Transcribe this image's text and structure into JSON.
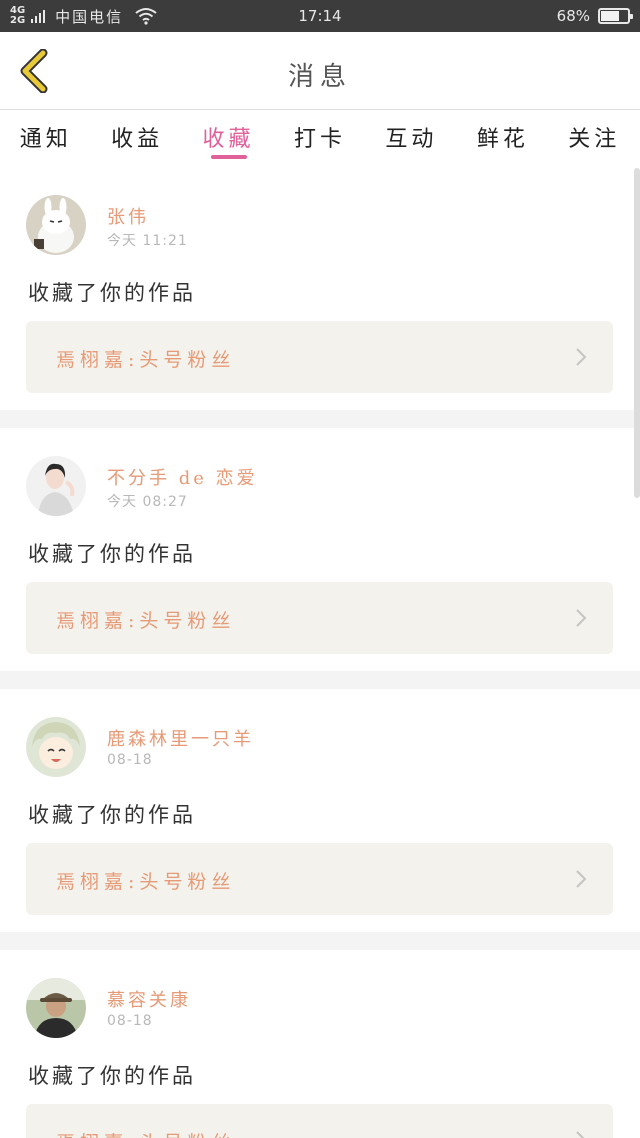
{
  "status_bar": {
    "network_top": "4G",
    "network_bottom": "2G",
    "carrier": "中国电信",
    "time": "17:14",
    "battery": "68%",
    "battery_level": 0.68
  },
  "header": {
    "title": "消息",
    "back_icon": "chevron-left-icon",
    "back_color": "#e8c938"
  },
  "tabs": [
    {
      "label": "通知",
      "active": false
    },
    {
      "label": "收益",
      "active": false
    },
    {
      "label": "收藏",
      "active": true
    },
    {
      "label": "打卡",
      "active": false
    },
    {
      "label": "互动",
      "active": false
    },
    {
      "label": "鲜花",
      "active": false
    },
    {
      "label": "关注",
      "active": false
    }
  ],
  "colors": {
    "accent": "#e0609a",
    "username": "#e69a76",
    "work_box_bg": "#f4f2ec"
  },
  "messages": [
    {
      "username": "张伟",
      "time": "今天 11:21",
      "action": "收藏了你的作品",
      "work": "焉栩嘉:头号粉丝",
      "avatar": "avatar-rabbit"
    },
    {
      "username": "不分手 de 恋爱",
      "time": "今天 08:27",
      "action": "收藏了你的作品",
      "work": "焉栩嘉:头号粉丝",
      "avatar": "avatar-girl"
    },
    {
      "username": "鹿森林里一只羊",
      "time": "08-18",
      "action": "收藏了你的作品",
      "work": "焉栩嘉:头号粉丝",
      "avatar": "avatar-anime"
    },
    {
      "username": "慕容关康",
      "time": "08-18",
      "action": "收藏了你的作品",
      "work": "焉栩嘉:头号粉丝",
      "avatar": "avatar-man"
    }
  ]
}
